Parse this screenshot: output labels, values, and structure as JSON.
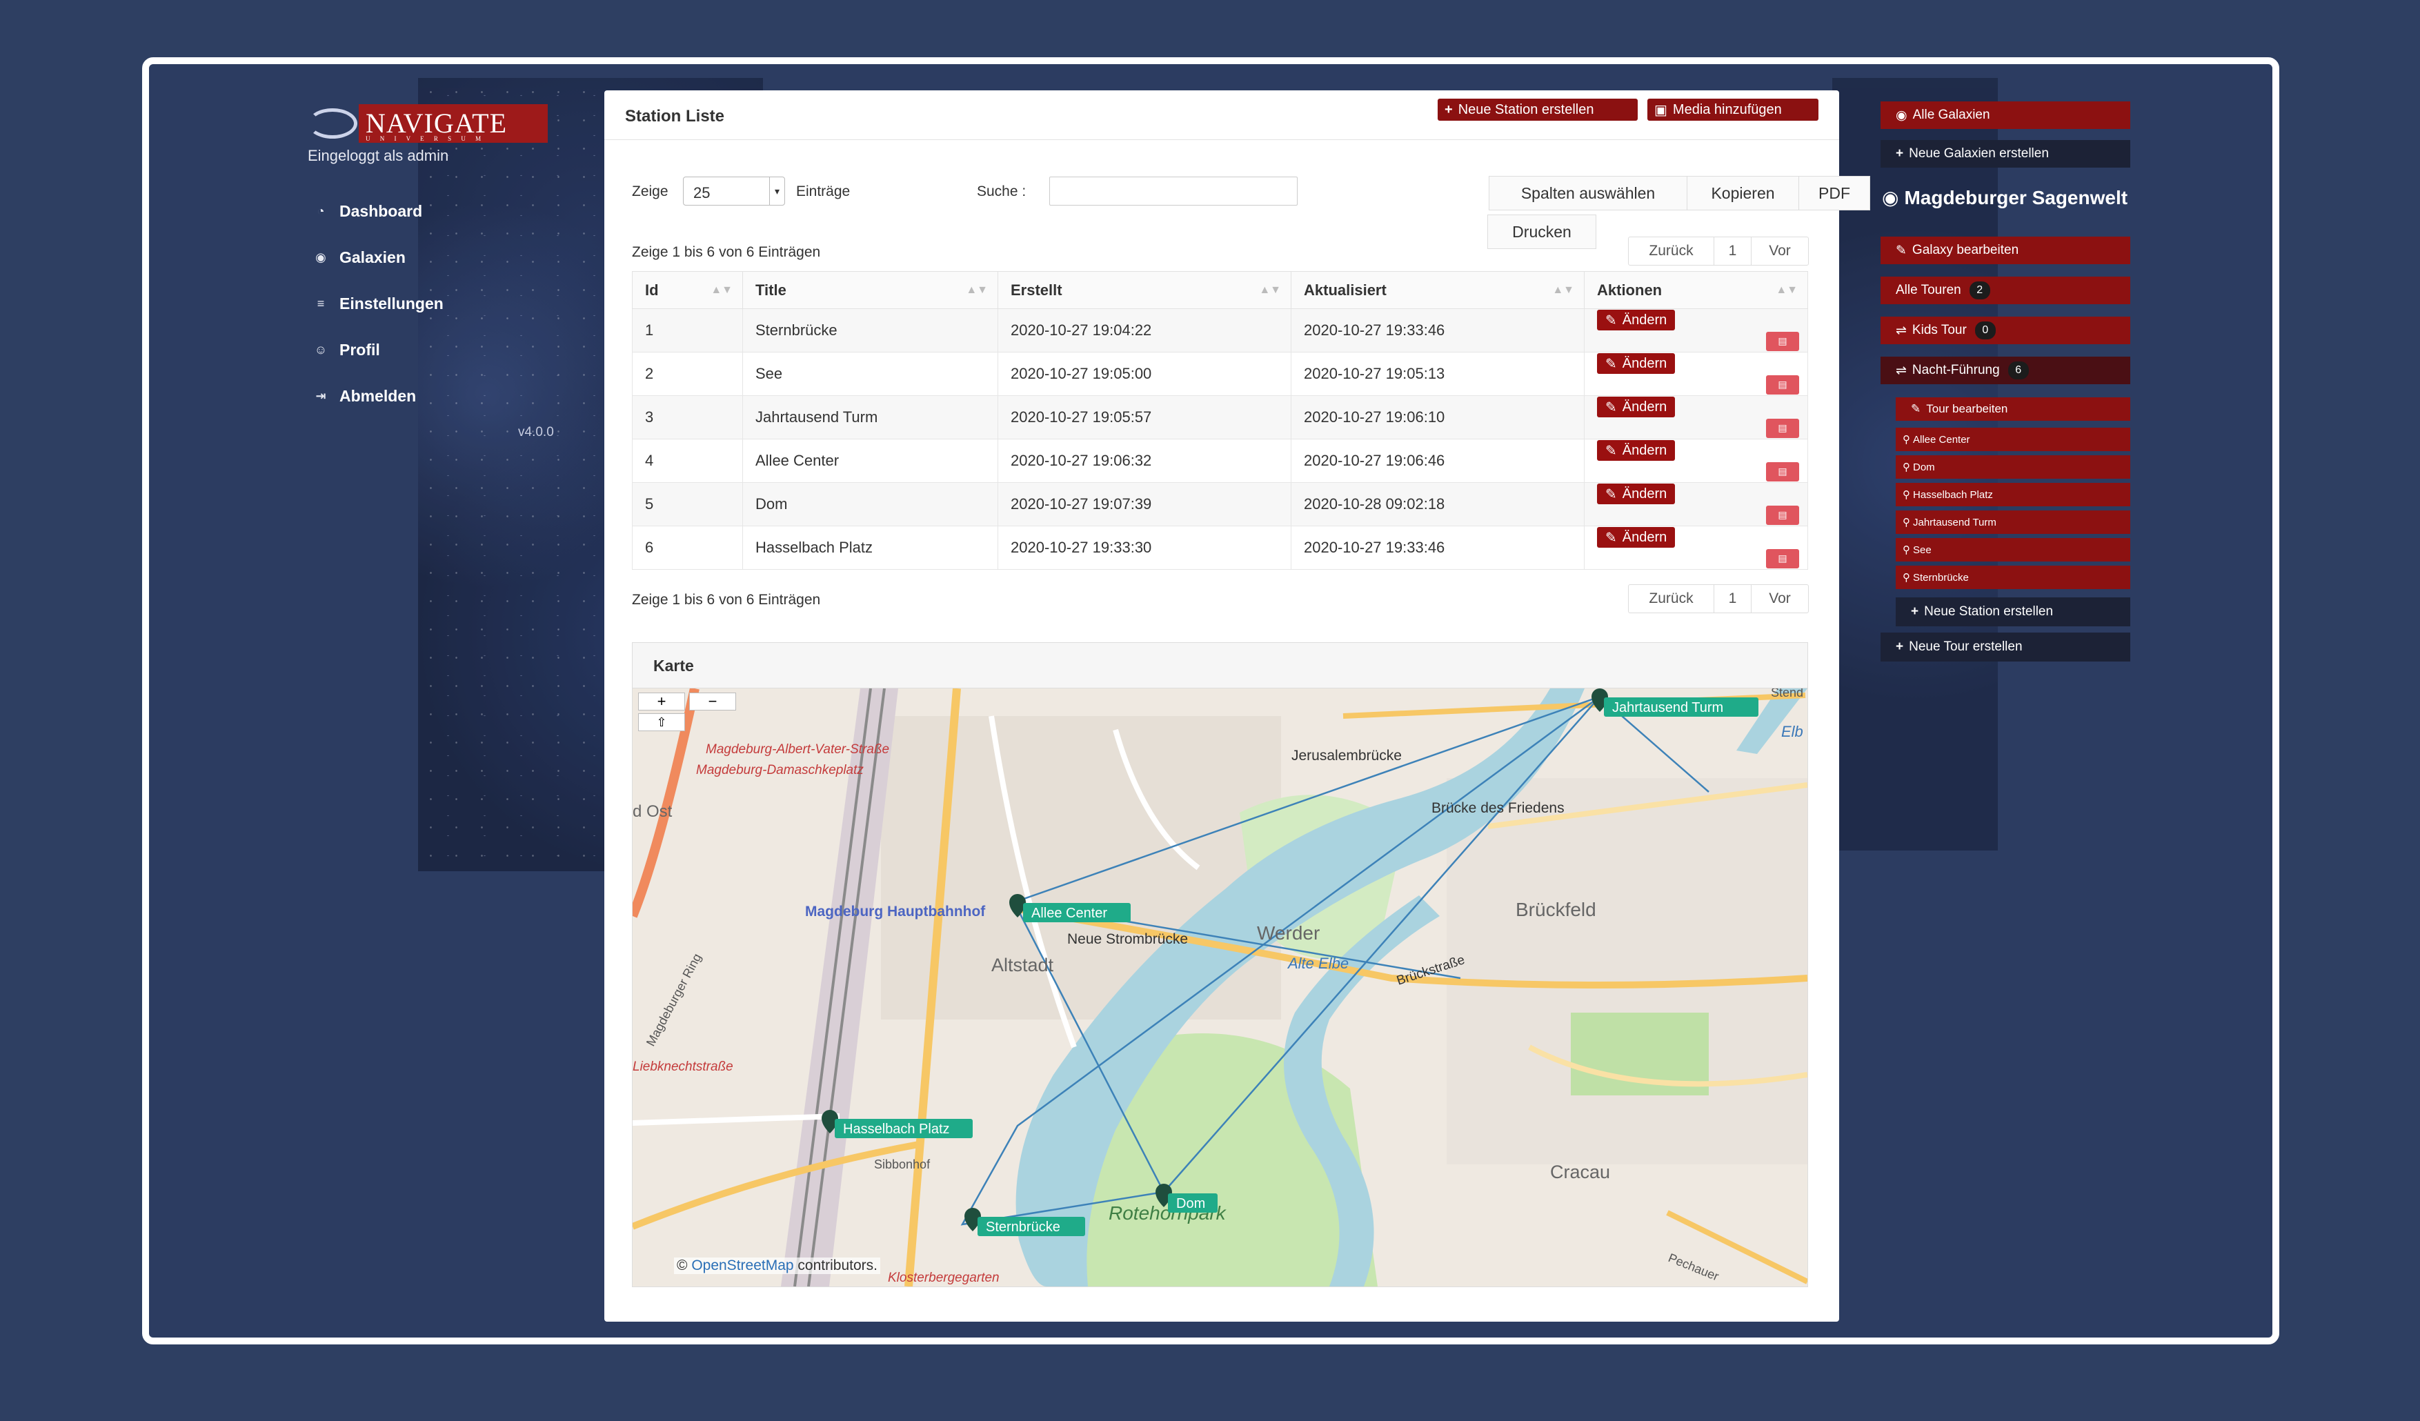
{
  "sidebar": {
    "brand": "NAVIGATE",
    "brand_sub": "U N I V E R S U M",
    "logged_in": "Eingeloggt als admin",
    "items": [
      {
        "label": "Dashboard",
        "icon": "dashboard-icon"
      },
      {
        "label": "Galaxien",
        "icon": "eye-icon"
      },
      {
        "label": "Einstellungen",
        "icon": "database-icon"
      },
      {
        "label": "Profil",
        "icon": "user-icon"
      },
      {
        "label": "Abmelden",
        "icon": "logout-icon"
      }
    ],
    "version": "v4.0.0"
  },
  "header": {
    "title": "Station Liste",
    "new_station": "Neue Station erstellen",
    "add_media": "Media hinzufügen"
  },
  "controls": {
    "show_label": "Zeige",
    "show_value": "25",
    "entries_label": "Einträge",
    "search_label": "Suche :",
    "search_value": "",
    "btn_columns": "Spalten auswählen",
    "btn_copy": "Kopieren",
    "btn_pdf": "PDF",
    "btn_print": "Drucken",
    "info_top": "Zeige 1 bis 6 von 6 Einträgen",
    "info_bottom": "Zeige 1 bis 6 von 6 Einträgen",
    "prev": "Zurück",
    "page": "1",
    "next": "Vor"
  },
  "table": {
    "columns": [
      "Id",
      "Title",
      "Erstellt",
      "Aktualisiert",
      "Aktionen"
    ],
    "edit_label": "Ändern",
    "rows": [
      {
        "id": "1",
        "title": "Sternbrücke",
        "created": "2020-10-27 19:04:22",
        "updated": "2020-10-27 19:33:46"
      },
      {
        "id": "2",
        "title": "See",
        "created": "2020-10-27 19:05:00",
        "updated": "2020-10-27 19:05:13"
      },
      {
        "id": "3",
        "title": "Jahrtausend Turm",
        "created": "2020-10-27 19:05:57",
        "updated": "2020-10-27 19:06:10"
      },
      {
        "id": "4",
        "title": "Allee Center",
        "created": "2020-10-27 19:06:32",
        "updated": "2020-10-27 19:06:46"
      },
      {
        "id": "5",
        "title": "Dom",
        "created": "2020-10-27 19:07:39",
        "updated": "2020-10-28 09:02:18"
      },
      {
        "id": "6",
        "title": "Hasselbach Platz",
        "created": "2020-10-27 19:33:30",
        "updated": "2020-10-27 19:33:46"
      }
    ]
  },
  "map": {
    "title": "Karte",
    "zoom_in": "+",
    "zoom_out": "−",
    "attribution_prefix": "© ",
    "attribution_link": "OpenStreetMap",
    "attribution_suffix": " contributors.",
    "labels": {
      "albert_vater": "Magdeburg-Albert-Vater-Straße",
      "damaschke": "Magdeburg-Damaschkeplatz",
      "ost": "d Ost",
      "hbf": "Magdeburg Hauptbahnhof",
      "ring": "Magdeburger Ring",
      "liebknecht": "Liebknechtstraße",
      "altstadt": "Altstadt",
      "neue_strom": "Neue Strombrücke",
      "werder": "Werder",
      "alte_elbe": "Alte Elbe",
      "jerusalem": "Jerusalembrücke",
      "bruecke_friedens": "Brücke des Friedens",
      "brueckfeld": "Brückfeld",
      "brueckstrasse": "Brückstraße",
      "cracau": "Cracau",
      "rotehorn": "Rotehornpark",
      "kloster": "Klosterbergegarten",
      "elb": "Elb",
      "stendal": "Stend",
      "sibbo": "Sibbonhof",
      "pechauer": "Pechauer"
    },
    "markers": [
      {
        "name": "Jahrtausend Turm"
      },
      {
        "name": "Allee Center"
      },
      {
        "name": "Hasselbach Platz"
      },
      {
        "name": "Dom"
      },
      {
        "name": "Sternbrücke"
      }
    ],
    "colors": {
      "water": "#aad3df",
      "park": "#c8e6b0",
      "road": "#f7c765",
      "marker": "#1fab89",
      "route": "#3d82b8"
    }
  },
  "right": {
    "all_galaxies": "Alle Galaxien",
    "new_galaxy": "Neue Galaxien erstellen",
    "galaxy_title": "Magdeburger Sagenwelt",
    "edit_galaxy": "Galaxy bearbeiten",
    "all_tours": "Alle Touren",
    "all_tours_count": "2",
    "kids_tour": "Kids Tour",
    "kids_count": "0",
    "night_tour": "Nacht-Führung",
    "night_count": "6",
    "edit_tour": "Tour bearbeiten",
    "stations": [
      "Allee Center",
      "Dom",
      "Hasselbach Platz",
      "Jahrtausend Turm",
      "See",
      "Sternbrücke"
    ],
    "new_station": "Neue Station erstellen",
    "new_tour": "Neue Tour erstellen"
  }
}
